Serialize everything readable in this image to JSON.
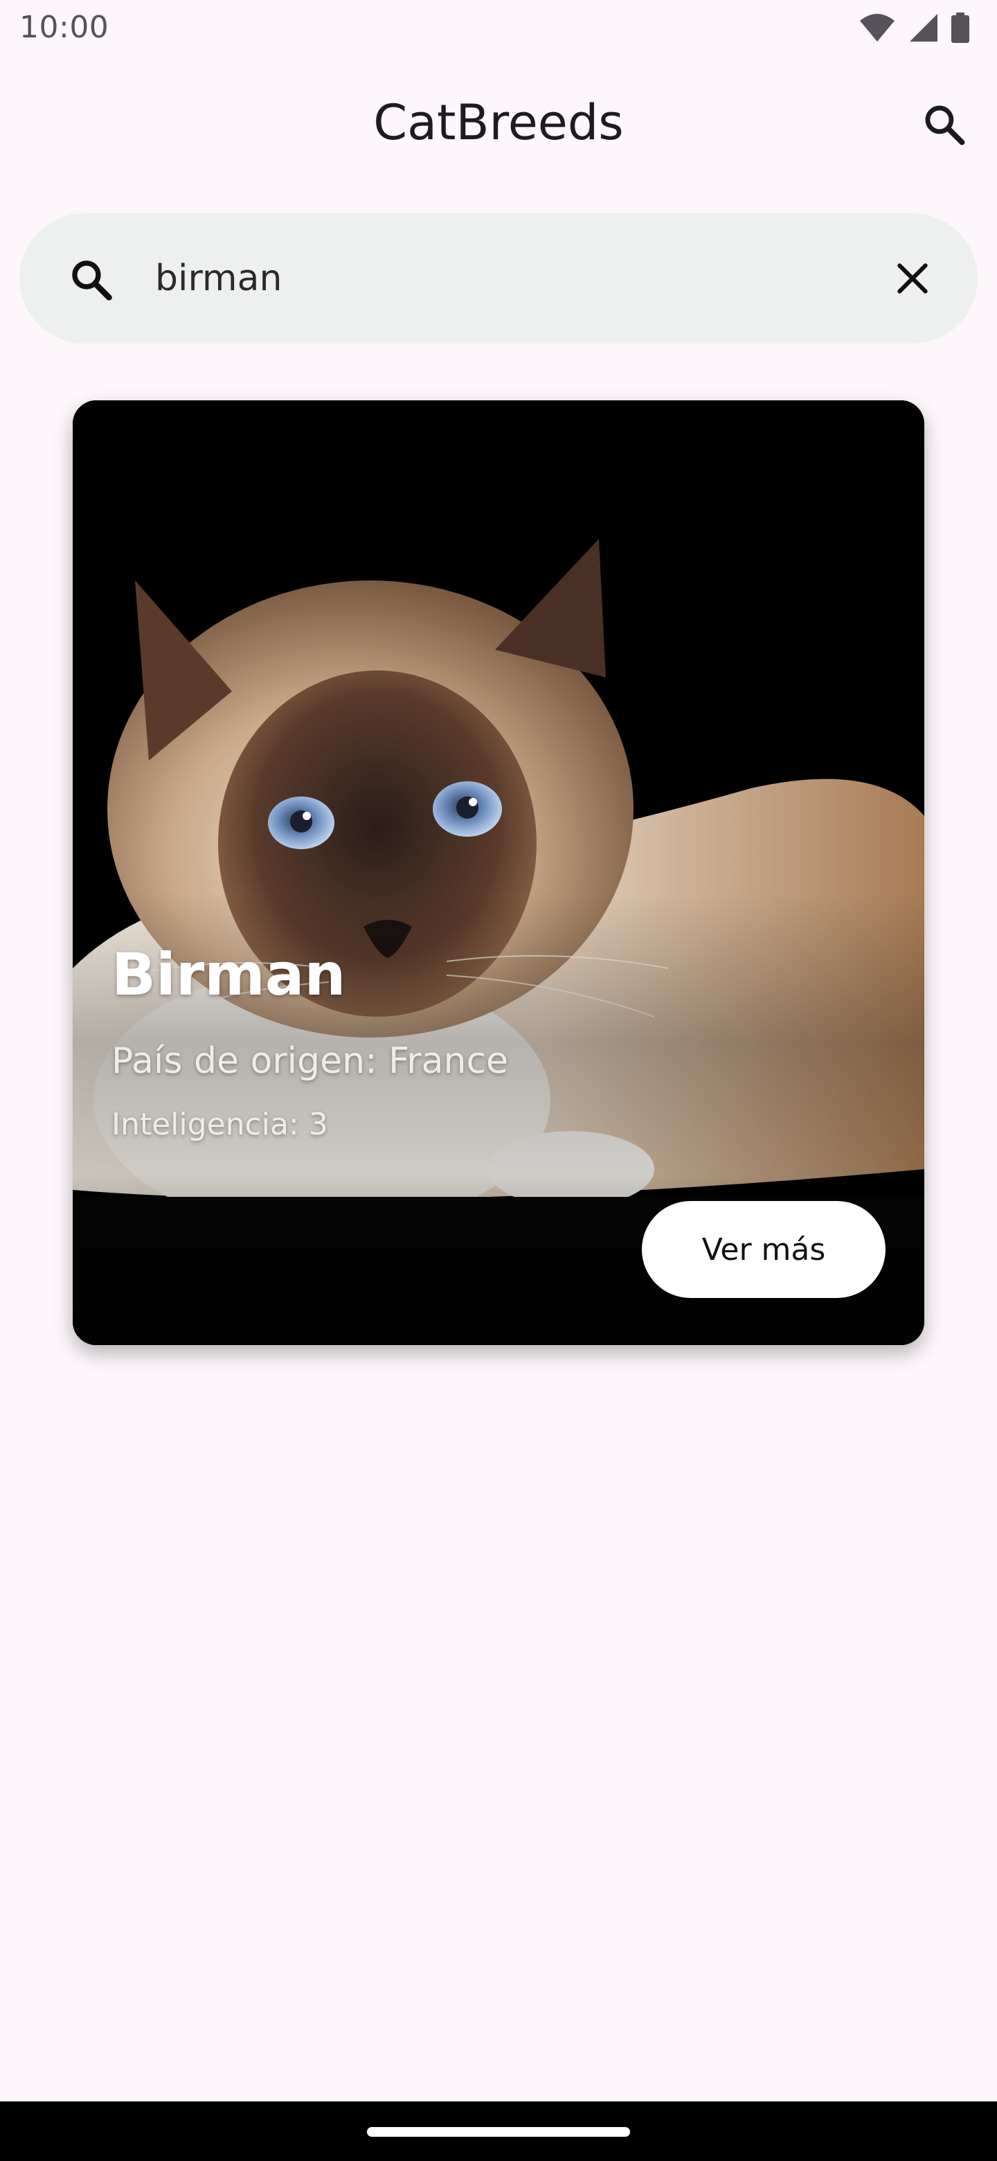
{
  "status_bar": {
    "time": "10:00",
    "icons": [
      "wifi-icon",
      "cellular-signal-icon",
      "battery-icon"
    ]
  },
  "app_bar": {
    "title": "CatBreeds",
    "action_icon": "search-icon"
  },
  "search": {
    "value": "birman",
    "leading_icon": "search-icon",
    "trailing_icon": "close-icon"
  },
  "breed_card": {
    "name": "Birman",
    "origin": "País de origen: France",
    "intelligence": "Inteligencia: 3",
    "more_label": "Ver más"
  },
  "colors": {
    "background": "#fdf7fb",
    "search_bar": "#eef0ef",
    "card_background": "#000000",
    "button": "#ffffff"
  }
}
